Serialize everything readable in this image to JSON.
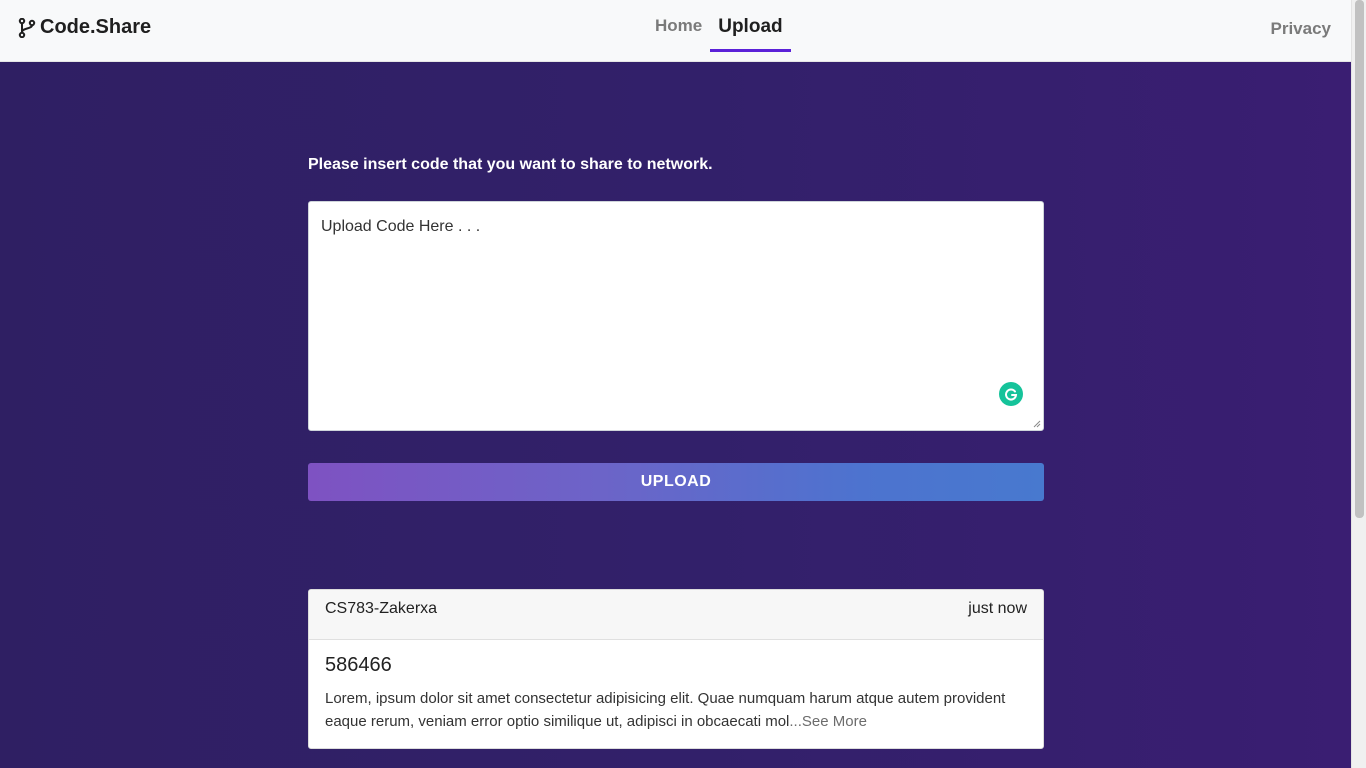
{
  "navbar": {
    "brand": "Code.Share",
    "links": [
      {
        "label": "Home",
        "active": false
      },
      {
        "label": "Upload",
        "active": true
      }
    ],
    "privacy": "Privacy",
    "active_underline_color": "#5b21d8"
  },
  "main": {
    "instruction": "Please insert code that you want to share to network.",
    "code_input": {
      "placeholder": "Upload Code Here . . .",
      "value": ""
    },
    "upload_button": "UPLOAD"
  },
  "post": {
    "author": "CS783-Zakerxa",
    "time": "just now",
    "title": "586466",
    "body": "Lorem, ipsum dolor sit amet consectetur adipisicing elit. Quae numquam harum atque autem provident eaque rerum, veniam error optio similique ut, adipisci in obcaecati mol",
    "see_more": "...See More"
  },
  "colors": {
    "background": "#32206a",
    "button_gradient_start": "#7e52c2",
    "button_gradient_end": "#4879cf",
    "grammarly": "#15c39a"
  },
  "icons": {
    "brand": "code-branch-icon",
    "assistant": "grammarly-icon"
  }
}
